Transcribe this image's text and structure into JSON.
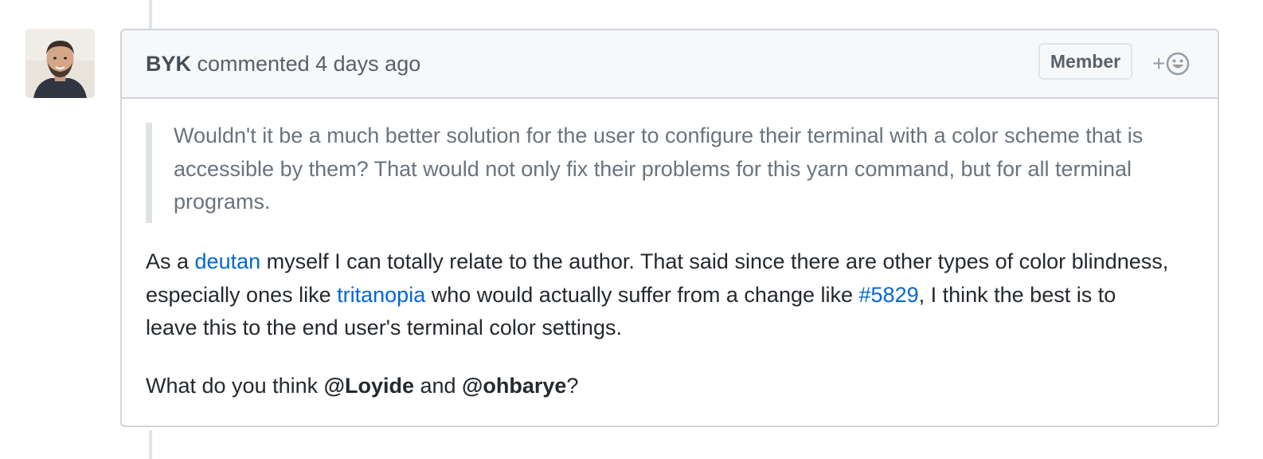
{
  "comment": {
    "author": "BYK",
    "action": "commented",
    "time": "4 days ago",
    "badge": "Member",
    "reaction_plus": "+",
    "quote": "Wouldn't it be a much better solution for the user to configure their terminal with a color scheme that is accessible by them? That would not only fix their problems for this yarn command, but for all terminal programs.",
    "para1": {
      "t1": "As a ",
      "link1": "deutan",
      "t2": " myself I can totally relate to the author. That said since there are other types of color blindness, especially ones like ",
      "link2": "tritanopia",
      "t3": " who would actually suffer from a change like ",
      "link3": "#5829",
      "t4": ", I think the best is to leave this to the end user's terminal color settings."
    },
    "para2": {
      "t1": "What do you think ",
      "mention1": "@Loyide",
      "t2": " and ",
      "mention2": "@ohbarye",
      "t3": "?"
    }
  },
  "icons": {
    "avatar": "avatar",
    "reaction": "smiley-icon"
  }
}
